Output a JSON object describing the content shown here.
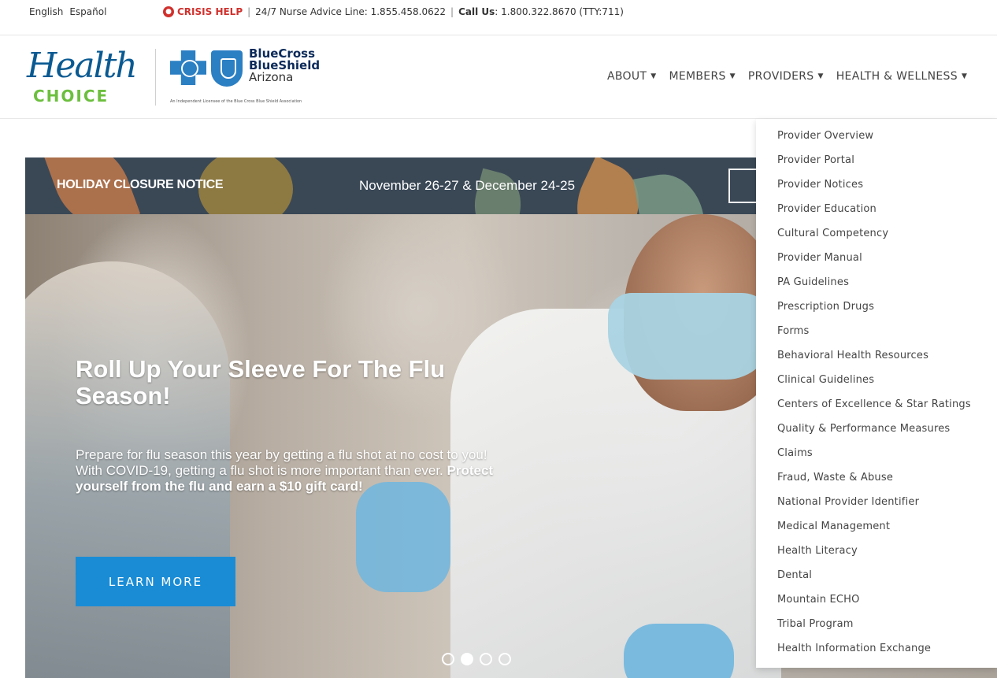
{
  "topbar": {
    "languages": [
      "English",
      "Español"
    ],
    "crisis_label": "CRISIS HELP",
    "nurse_line": "24/7 Nurse Advice Line: 1.855.458.0622",
    "call_label": "Call Us",
    "call_number": ": 1.800.322.8670 (TTY:711)",
    "separator": "|"
  },
  "logos": {
    "health": "Health",
    "choice": "CHOICE",
    "bc_line1": "BlueCross",
    "bc_line2": "BlueShield",
    "bc_line3": "Arizona",
    "bc_sub": "An Independent Licensee of the Blue Cross Blue Shield Association"
  },
  "nav": {
    "items": [
      "ABOUT",
      "MEMBERS",
      "PROVIDERS",
      "HEALTH & WELLNESS"
    ]
  },
  "dropdown": {
    "items": [
      "Provider Overview",
      "Provider Portal",
      "Provider Notices",
      "Provider Education",
      "Cultural Competency",
      "Provider Manual",
      "PA Guidelines",
      "Prescription Drugs",
      "Forms",
      "Behavioral Health Resources",
      "Clinical Guidelines",
      "Centers of Excellence & Star Ratings",
      "Quality & Performance Measures",
      "Claims",
      "Fraud, Waste & Abuse",
      "National Provider Identifier",
      "Medical Management",
      "Health Literacy",
      "Dental",
      "Mountain ECHO",
      "Tribal Program",
      "Health Information Exchange"
    ]
  },
  "banner": {
    "title": "HOLIDAY CLOSURE NOTICE",
    "dates": "November 26-27 & December 24-25"
  },
  "hero": {
    "title": "Roll Up Your Sleeve For The Flu Season!",
    "text_plain": "Prepare for flu season this year by getting a flu shot at no cost to you! With COVID-19, getting a flu shot is more important than ever. ",
    "text_bold": "Protect yourself from the flu and earn a $10 gift card!",
    "button": "LEARN MORE"
  },
  "carousel": {
    "count": 4,
    "active_index": 1
  },
  "colors": {
    "brand_blue": "#1a8cd6",
    "crisis_red": "#d0312d",
    "choice_green": "#6cbf3e",
    "banner_bg": "#3a4856"
  }
}
